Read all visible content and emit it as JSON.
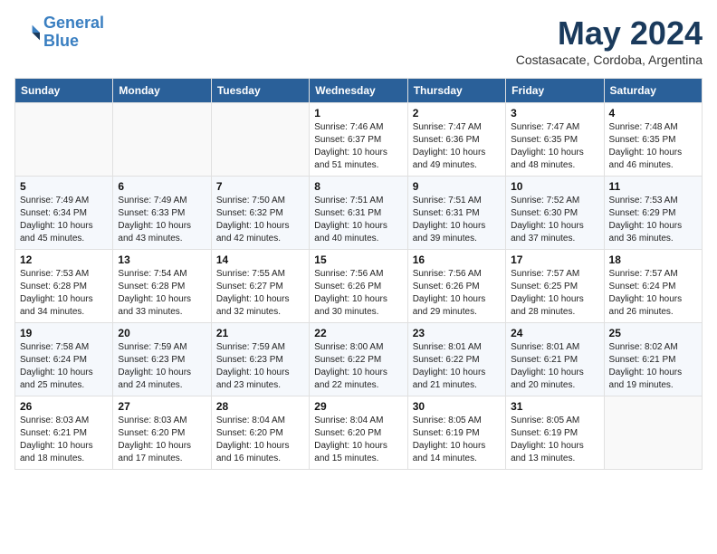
{
  "header": {
    "logo_line1": "General",
    "logo_line2": "Blue",
    "month": "May 2024",
    "location": "Costasacate, Cordoba, Argentina"
  },
  "weekdays": [
    "Sunday",
    "Monday",
    "Tuesday",
    "Wednesday",
    "Thursday",
    "Friday",
    "Saturday"
  ],
  "weeks": [
    [
      {
        "day": "",
        "info": ""
      },
      {
        "day": "",
        "info": ""
      },
      {
        "day": "",
        "info": ""
      },
      {
        "day": "1",
        "info": "Sunrise: 7:46 AM\nSunset: 6:37 PM\nDaylight: 10 hours\nand 51 minutes."
      },
      {
        "day": "2",
        "info": "Sunrise: 7:47 AM\nSunset: 6:36 PM\nDaylight: 10 hours\nand 49 minutes."
      },
      {
        "day": "3",
        "info": "Sunrise: 7:47 AM\nSunset: 6:35 PM\nDaylight: 10 hours\nand 48 minutes."
      },
      {
        "day": "4",
        "info": "Sunrise: 7:48 AM\nSunset: 6:35 PM\nDaylight: 10 hours\nand 46 minutes."
      }
    ],
    [
      {
        "day": "5",
        "info": "Sunrise: 7:49 AM\nSunset: 6:34 PM\nDaylight: 10 hours\nand 45 minutes."
      },
      {
        "day": "6",
        "info": "Sunrise: 7:49 AM\nSunset: 6:33 PM\nDaylight: 10 hours\nand 43 minutes."
      },
      {
        "day": "7",
        "info": "Sunrise: 7:50 AM\nSunset: 6:32 PM\nDaylight: 10 hours\nand 42 minutes."
      },
      {
        "day": "8",
        "info": "Sunrise: 7:51 AM\nSunset: 6:31 PM\nDaylight: 10 hours\nand 40 minutes."
      },
      {
        "day": "9",
        "info": "Sunrise: 7:51 AM\nSunset: 6:31 PM\nDaylight: 10 hours\nand 39 minutes."
      },
      {
        "day": "10",
        "info": "Sunrise: 7:52 AM\nSunset: 6:30 PM\nDaylight: 10 hours\nand 37 minutes."
      },
      {
        "day": "11",
        "info": "Sunrise: 7:53 AM\nSunset: 6:29 PM\nDaylight: 10 hours\nand 36 minutes."
      }
    ],
    [
      {
        "day": "12",
        "info": "Sunrise: 7:53 AM\nSunset: 6:28 PM\nDaylight: 10 hours\nand 34 minutes."
      },
      {
        "day": "13",
        "info": "Sunrise: 7:54 AM\nSunset: 6:28 PM\nDaylight: 10 hours\nand 33 minutes."
      },
      {
        "day": "14",
        "info": "Sunrise: 7:55 AM\nSunset: 6:27 PM\nDaylight: 10 hours\nand 32 minutes."
      },
      {
        "day": "15",
        "info": "Sunrise: 7:56 AM\nSunset: 6:26 PM\nDaylight: 10 hours\nand 30 minutes."
      },
      {
        "day": "16",
        "info": "Sunrise: 7:56 AM\nSunset: 6:26 PM\nDaylight: 10 hours\nand 29 minutes."
      },
      {
        "day": "17",
        "info": "Sunrise: 7:57 AM\nSunset: 6:25 PM\nDaylight: 10 hours\nand 28 minutes."
      },
      {
        "day": "18",
        "info": "Sunrise: 7:57 AM\nSunset: 6:24 PM\nDaylight: 10 hours\nand 26 minutes."
      }
    ],
    [
      {
        "day": "19",
        "info": "Sunrise: 7:58 AM\nSunset: 6:24 PM\nDaylight: 10 hours\nand 25 minutes."
      },
      {
        "day": "20",
        "info": "Sunrise: 7:59 AM\nSunset: 6:23 PM\nDaylight: 10 hours\nand 24 minutes."
      },
      {
        "day": "21",
        "info": "Sunrise: 7:59 AM\nSunset: 6:23 PM\nDaylight: 10 hours\nand 23 minutes."
      },
      {
        "day": "22",
        "info": "Sunrise: 8:00 AM\nSunset: 6:22 PM\nDaylight: 10 hours\nand 22 minutes."
      },
      {
        "day": "23",
        "info": "Sunrise: 8:01 AM\nSunset: 6:22 PM\nDaylight: 10 hours\nand 21 minutes."
      },
      {
        "day": "24",
        "info": "Sunrise: 8:01 AM\nSunset: 6:21 PM\nDaylight: 10 hours\nand 20 minutes."
      },
      {
        "day": "25",
        "info": "Sunrise: 8:02 AM\nSunset: 6:21 PM\nDaylight: 10 hours\nand 19 minutes."
      }
    ],
    [
      {
        "day": "26",
        "info": "Sunrise: 8:03 AM\nSunset: 6:21 PM\nDaylight: 10 hours\nand 18 minutes."
      },
      {
        "day": "27",
        "info": "Sunrise: 8:03 AM\nSunset: 6:20 PM\nDaylight: 10 hours\nand 17 minutes."
      },
      {
        "day": "28",
        "info": "Sunrise: 8:04 AM\nSunset: 6:20 PM\nDaylight: 10 hours\nand 16 minutes."
      },
      {
        "day": "29",
        "info": "Sunrise: 8:04 AM\nSunset: 6:20 PM\nDaylight: 10 hours\nand 15 minutes."
      },
      {
        "day": "30",
        "info": "Sunrise: 8:05 AM\nSunset: 6:19 PM\nDaylight: 10 hours\nand 14 minutes."
      },
      {
        "day": "31",
        "info": "Sunrise: 8:05 AM\nSunset: 6:19 PM\nDaylight: 10 hours\nand 13 minutes."
      },
      {
        "day": "",
        "info": ""
      }
    ]
  ]
}
